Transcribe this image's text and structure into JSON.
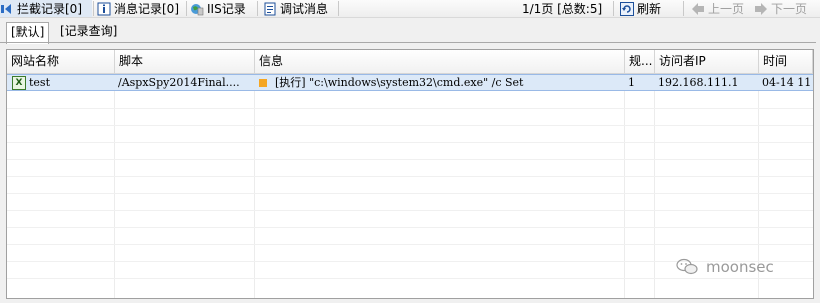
{
  "toolbar": {
    "intercept_log": "拦截记录[0]",
    "message_log": "消息记录[0]",
    "iis_log": "IIS记录",
    "debug_message": "调试消息",
    "page_info": "1/1页 [总数:5]",
    "refresh": "刷新",
    "prev_page": "上一页",
    "next_page": "下一页"
  },
  "tabs": [
    {
      "label": "[默认]",
      "selected": true
    },
    {
      "label": "[记录查询]",
      "selected": false
    }
  ],
  "table": {
    "columns": [
      "网站名称",
      "脚本",
      "信息",
      "规...",
      "访问者IP",
      "时间"
    ],
    "rows": [
      {
        "site": "test",
        "script": "/AspxSpy2014Final....",
        "info": "[执行] \"c:\\windows\\system32\\cmd.exe\" /c Set",
        "rule": "1",
        "ip": "192.168.111.1",
        "time": "04-14 11"
      }
    ]
  },
  "watermark": {
    "text": "moonsec"
  },
  "colors": {
    "selected_row": "#dce9f8",
    "warning_marker": "#f5a623",
    "excel_icon": "#3b7a2a"
  }
}
